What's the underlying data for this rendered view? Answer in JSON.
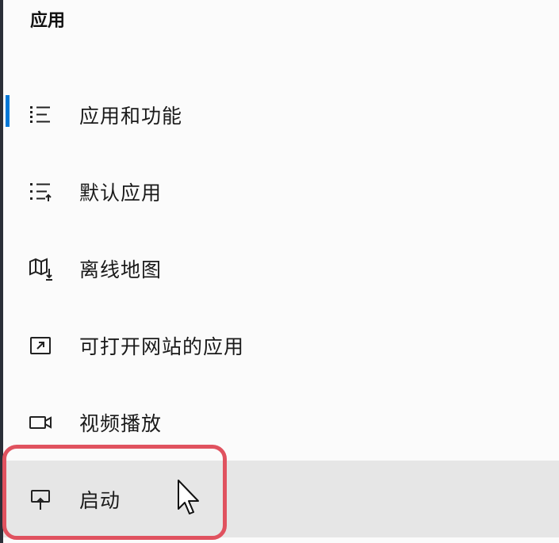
{
  "section": {
    "title": "应用"
  },
  "nav": {
    "items": [
      {
        "label": "应用和功能",
        "icon": "apps-features-icon",
        "selected": true
      },
      {
        "label": "默认应用",
        "icon": "default-apps-icon"
      },
      {
        "label": "离线地图",
        "icon": "offline-maps-icon"
      },
      {
        "label": "可打开网站的应用",
        "icon": "apps-for-websites-icon"
      },
      {
        "label": "视频播放",
        "icon": "video-playback-icon"
      },
      {
        "label": "启动",
        "icon": "startup-icon",
        "hovered": true
      }
    ]
  },
  "colors": {
    "accent": "#0078d7",
    "highlight": "#e0525f",
    "hover_bg": "#e6e6e6"
  }
}
